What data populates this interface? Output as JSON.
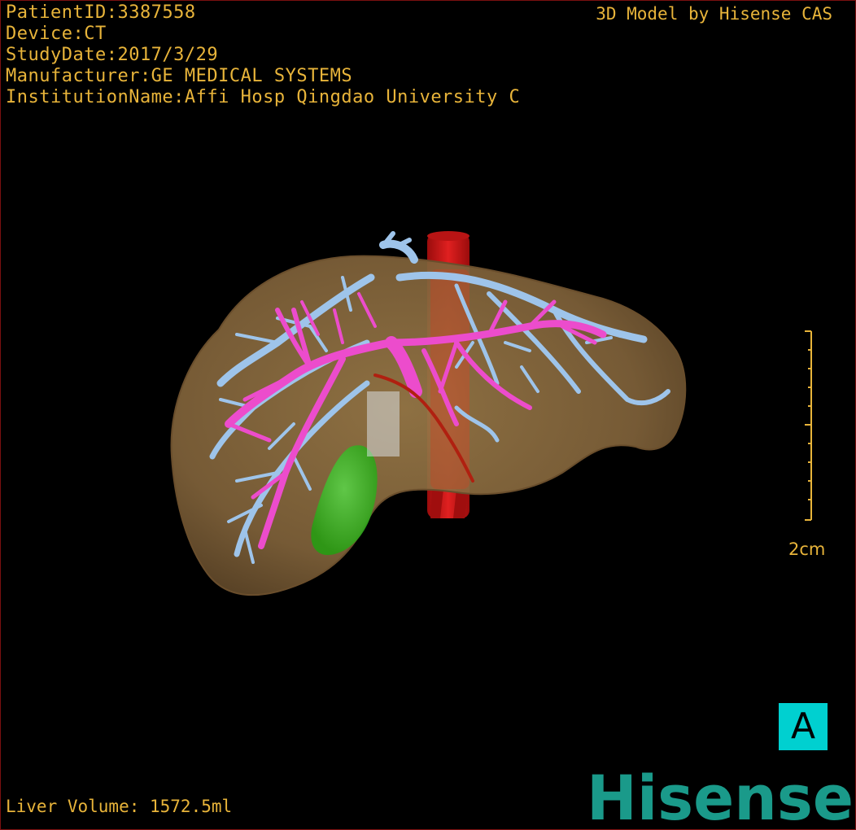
{
  "patient_info": {
    "patient_id": "PatientID:3387558",
    "device": "Device:CT",
    "study_date": "StudyDate:2017/3/29",
    "manufacturer": "Manufacturer:GE MEDICAL SYSTEMS",
    "institution": "InstitutionName:Affi Hosp Qingdao University C"
  },
  "model_credit": "3D Model by Hisense CAS",
  "liver_volume": "Liver Volume: 1572.5ml",
  "scale": {
    "label": "2cm"
  },
  "orientation": "A",
  "brand": "Hisense",
  "colors": {
    "overlay_text": "#e8b43a",
    "liver": "#8a6a3c",
    "hepatic_vein": "#9ec4ea",
    "portal_vein": "#ec4ccc",
    "artery": "#d41818",
    "gallbladder": "#34c020",
    "brand": "#1a9a8a",
    "orientation_badge": "#00d0d0"
  },
  "structures": {
    "liver": "liver-surface",
    "hepatic_vein": "hepatic-vein-tree",
    "portal_vein": "portal-vein-tree",
    "artery": "aorta",
    "gallbladder": "gallbladder"
  }
}
